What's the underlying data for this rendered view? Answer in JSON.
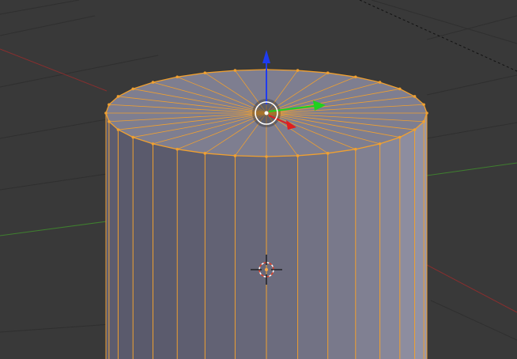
{
  "viewport": {
    "background": "#393939",
    "grid_color": "#2f2f2f",
    "axis_x_color": "#8a2e2e",
    "axis_y_color": "#3f7f2f"
  },
  "mesh": {
    "object": "cylinder",
    "mode": "edit",
    "top_vertex_count": 32,
    "selection_color": "#f0a030",
    "face_color": "#8c8ca0"
  },
  "gizmo": {
    "type": "translate",
    "x_color": "#e01e1e",
    "y_color": "#1ed21e",
    "z_color": "#1e3cf0"
  },
  "cursor_3d": {
    "colors": [
      "#ffffff",
      "#e0422a"
    ]
  }
}
